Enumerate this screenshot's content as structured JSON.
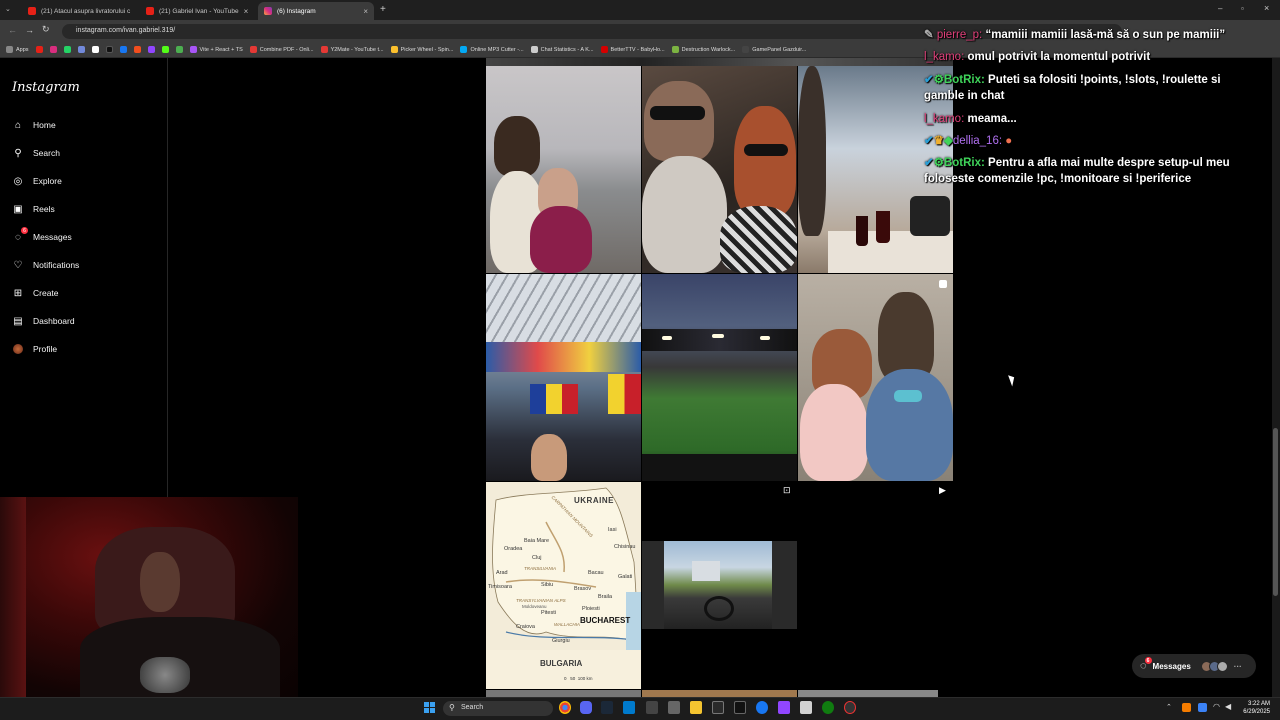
{
  "browser": {
    "tabs": [
      {
        "title": "(21) Atacul asupra livratorului c",
        "active": false
      },
      {
        "title": "(21) Gabriel Ivan - YouTube",
        "active": false
      },
      {
        "title": "(6) Instagram",
        "active": true
      }
    ],
    "new_tab": "+",
    "url": "instagram.com/ivan.gabriel.319/",
    "bookmarks": [
      "Apps",
      "Vite + React + TS",
      "Combine PDF - Onli...",
      "Y2Mate - YouTube t...",
      "Picker Wheel - Spin...",
      "Online MP3 Cutter -...",
      "Chat Statistics - A K...",
      "BetterTTV - BabyHo...",
      "Destruction Warlock...",
      "GamePanel Gazduir..."
    ]
  },
  "sidebar": {
    "logo": "Instagram",
    "items": [
      {
        "label": "Home",
        "icon": "home-icon"
      },
      {
        "label": "Search",
        "icon": "search-icon"
      },
      {
        "label": "Explore",
        "icon": "compass-icon"
      },
      {
        "label": "Reels",
        "icon": "reels-icon"
      },
      {
        "label": "Messages",
        "icon": "messenger-icon",
        "badge": "6"
      },
      {
        "label": "Notifications",
        "icon": "heart-icon"
      },
      {
        "label": "Create",
        "icon": "plus-square-icon"
      },
      {
        "label": "Dashboard",
        "icon": "dashboard-icon"
      },
      {
        "label": "Profile",
        "icon": "avatar-icon"
      }
    ]
  },
  "grid": {
    "map_labels": {
      "country_top": "UKRAINE",
      "capital": "BUCHAREST",
      "country_bottom": "BULGARIA",
      "cities": [
        "Baia Mare",
        "Oradea",
        "Cluj",
        "Arad",
        "Timisoara",
        "Sibiu",
        "Craiova",
        "Pitesti",
        "Ploiesti",
        "Brasov",
        "Bacau",
        "Iasi",
        "Chisinau",
        "Galati",
        "Braila",
        "Giurgiu"
      ],
      "regions": [
        "CARPATHIAN MOUNTAINS",
        "TRANSILVANIA",
        "TRANSYLVANIAN ALPS",
        "WALLACHIA",
        "Moldoveanu"
      ],
      "scale": "0   50  100 km"
    }
  },
  "chat": [
    {
      "user": "pierre_p:",
      "message": "“mamiii mamiii lasă-mă să o sun pe mamiii”"
    },
    {
      "user": "l_kamo:",
      "message": "omul potrivit la momentul potrivit"
    },
    {
      "user": "BotRix:",
      "message": "Puteti sa folositi !points, !slots, !roulette si gamble in chat"
    },
    {
      "user": "l_kamo:",
      "message": "meama..."
    },
    {
      "user": "dellia_16:",
      "message": ""
    },
    {
      "user": "BotRix:",
      "message": "Pentru a afla mai multe despre setup-ul meu foloseste comenzile !pc, !monitoare si !periferice"
    }
  ],
  "messages_pill": {
    "label": "Messages",
    "badge": "6"
  },
  "taskbar": {
    "search": "Search",
    "time": "3:22 AM",
    "date": "6/29/2025"
  }
}
